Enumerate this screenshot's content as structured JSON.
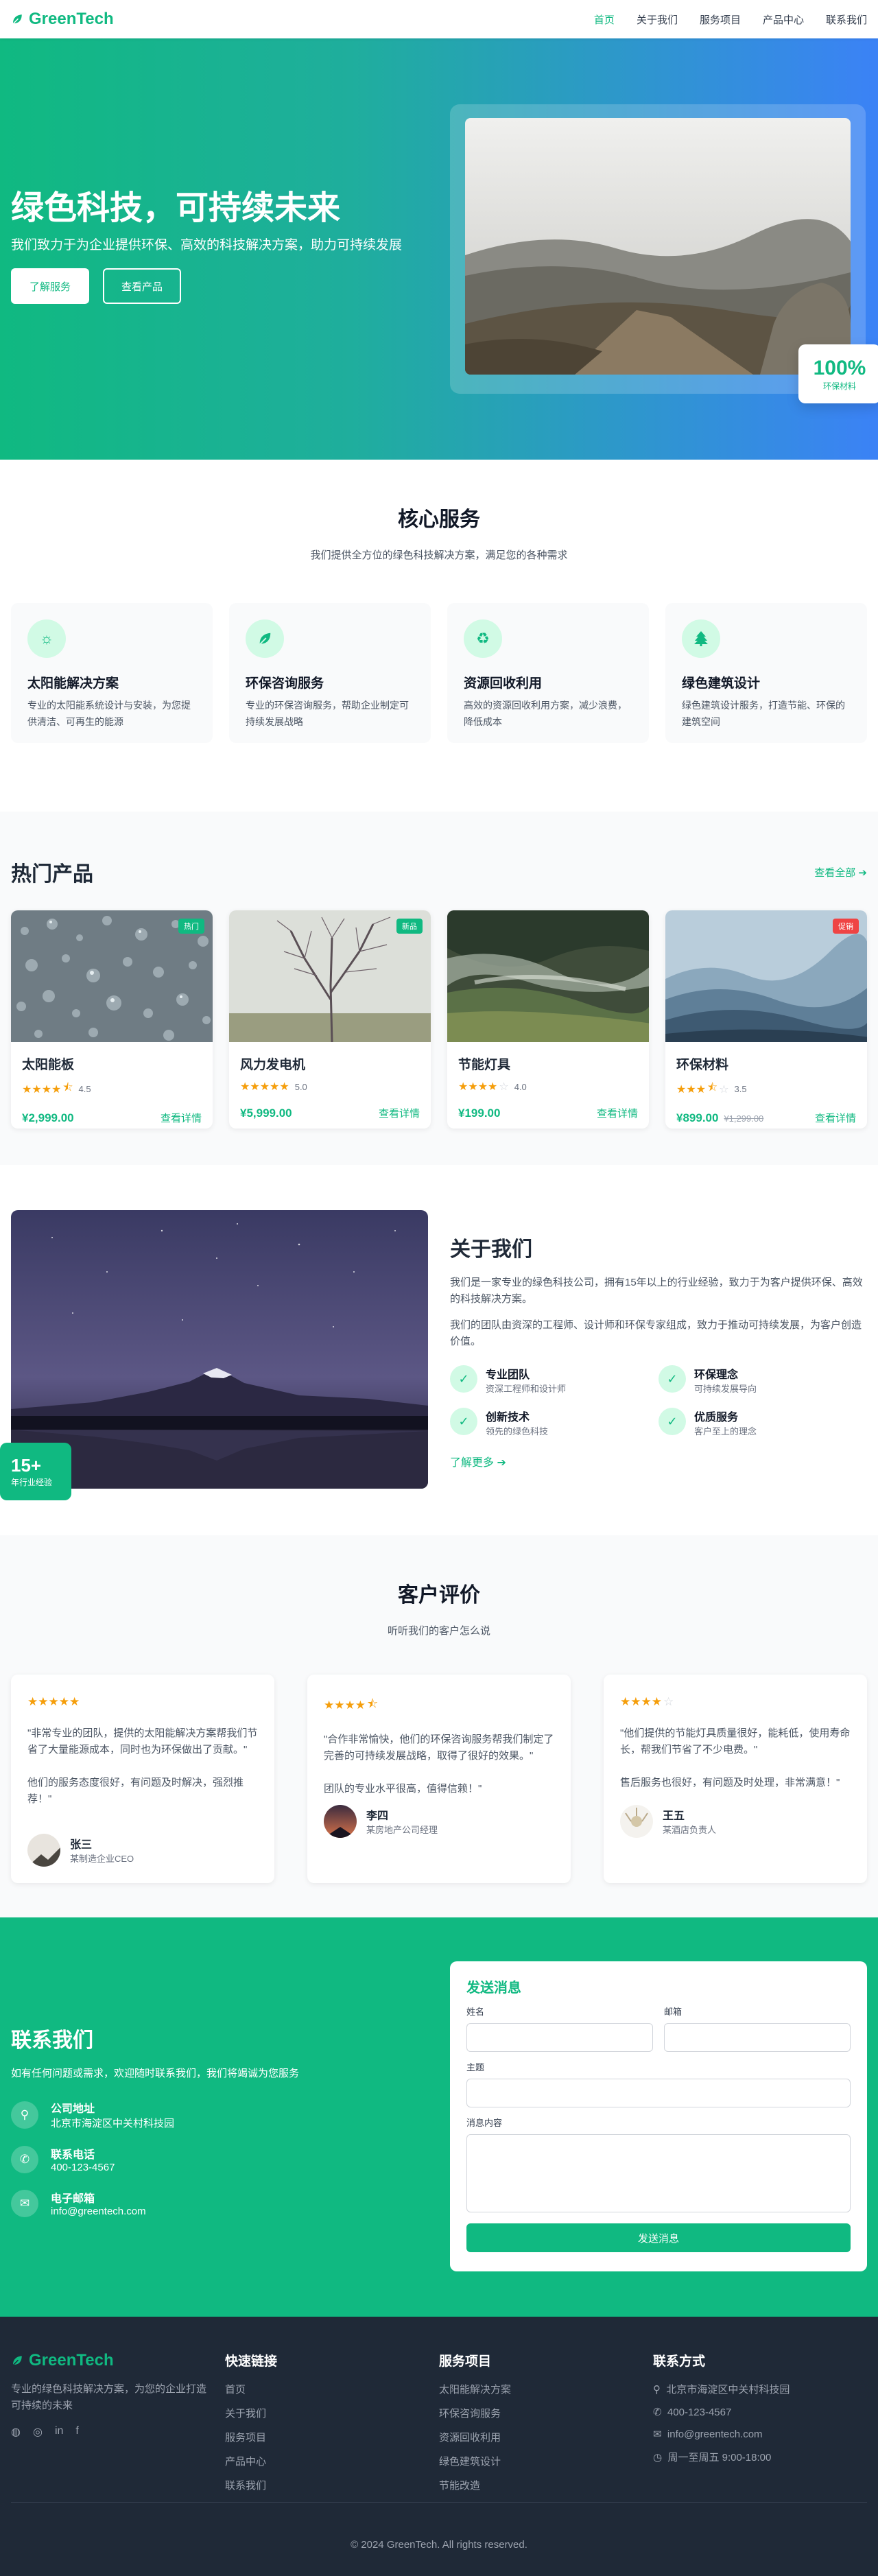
{
  "nav": {
    "logo": "GreenTech",
    "links": [
      "首页",
      "关于我们",
      "服务项目",
      "产品中心",
      "联系我们"
    ]
  },
  "hero": {
    "title": "绿色科技，可持续未来",
    "subtitle": "我们致力于为企业提供环保、高效的科技解决方案，助力可持续发展",
    "btn_primary": "了解服务",
    "btn_secondary": "查看产品",
    "badge_value": "100%",
    "badge_label": "环保材料"
  },
  "services": {
    "title": "核心服务",
    "subtitle": "我们提供全方位的绿色科技解决方案，满足您的各种需求",
    "items": [
      {
        "icon": "sun-icon",
        "title": "太阳能解决方案",
        "desc": "专业的太阳能系统设计与安装，为您提供清洁、可再生的能源"
      },
      {
        "icon": "leaf-icon",
        "title": "环保咨询服务",
        "desc": "专业的环保咨询服务，帮助企业制定可持续发展战略"
      },
      {
        "icon": "recycle-icon",
        "title": "资源回收利用",
        "desc": "高效的资源回收利用方案，减少浪费，降低成本"
      },
      {
        "icon": "tree-icon",
        "title": "绿色建筑设计",
        "desc": "绿色建筑设计服务，打造节能、环保的建筑空间"
      }
    ]
  },
  "products": {
    "title": "热门产品",
    "view_all": "查看全部",
    "detail_label": "查看详情",
    "items": [
      {
        "name": "太阳能板",
        "rating": "4.5",
        "stars": 4.5,
        "price": "¥2,999.00",
        "old_price": "",
        "tag": "热门",
        "tag_color": "#10b981"
      },
      {
        "name": "风力发电机",
        "rating": "5.0",
        "stars": 5,
        "price": "¥5,999.00",
        "old_price": "",
        "tag": "新品",
        "tag_color": "#10b981"
      },
      {
        "name": "节能灯具",
        "rating": "4.0",
        "stars": 4,
        "price": "¥199.00",
        "old_price": "",
        "tag": "",
        "tag_color": ""
      },
      {
        "name": "环保材料",
        "rating": "3.5",
        "stars": 3.5,
        "price": "¥899.00",
        "old_price": "¥1,299.00",
        "tag": "促销",
        "tag_color": "#ef4444"
      }
    ]
  },
  "about": {
    "title": "关于我们",
    "p1": "我们是一家专业的绿色科技公司，拥有15年以上的行业经验，致力于为客户提供环保、高效的科技解决方案。",
    "p2": "我们的团队由资深的工程师、设计师和环保专家组成，致力于推动可持续发展，为客户创造价值。",
    "badge_value": "15+",
    "badge_label": "年行业经验",
    "features": [
      {
        "title": "专业团队",
        "desc": "资深工程师和设计师"
      },
      {
        "title": "环保理念",
        "desc": "可持续发展导向"
      },
      {
        "title": "创新技术",
        "desc": "领先的绿色科技"
      },
      {
        "title": "优质服务",
        "desc": "客户至上的理念"
      }
    ],
    "more": "了解更多"
  },
  "reviews": {
    "title": "客户评价",
    "subtitle": "听听我们的客户怎么说",
    "items": [
      {
        "stars": 5,
        "text": "\"非常专业的团队，提供的太阳能解决方案帮我们节省了大量能源成本，同时也为环保做出了贡献。\"\n\n他们的服务态度很好，有问题及时解决，强烈推荐！\"",
        "name": "张三",
        "role": "某制造企业CEO"
      },
      {
        "stars": 4.5,
        "text": "\"合作非常愉快，他们的环保咨询服务帮我们制定了完善的可持续发展战略，取得了很好的效果。\"\n\n团队的专业水平很高，值得信赖！\"",
        "name": "李四",
        "role": "某房地产公司经理"
      },
      {
        "stars": 4,
        "text": "\"他们提供的节能灯具质量很好，能耗低，使用寿命长，帮我们节省了不少电费。\"\n\n售后服务也很好，有问题及时处理，非常满意！\"",
        "name": "王五",
        "role": "某酒店负责人"
      }
    ]
  },
  "contact": {
    "title": "联系我们",
    "subtitle": "如有任何问题或需求，欢迎随时联系我们，我们将竭诚为您服务",
    "items": [
      {
        "icon": "location-icon",
        "label": "公司地址",
        "value": "北京市海淀区中关村科技园"
      },
      {
        "icon": "phone-icon",
        "label": "联系电话",
        "value": "400-123-4567"
      },
      {
        "icon": "mail-icon",
        "label": "电子邮箱",
        "value": "info@greentech.com"
      }
    ],
    "form": {
      "title": "发送消息",
      "name_label": "姓名",
      "email_label": "邮箱",
      "subject_label": "主题",
      "message_label": "消息内容",
      "submit": "发送消息"
    }
  },
  "footer": {
    "logo": "GreenTech",
    "desc": "专业的绿色科技解决方案，为您的企业打造可持续的未来",
    "quick_title": "快速链接",
    "quick_links": [
      "首页",
      "关于我们",
      "服务项目",
      "产品中心",
      "联系我们"
    ],
    "service_title": "服务项目",
    "service_links": [
      "太阳能解决方案",
      "环保咨询服务",
      "资源回收利用",
      "绿色建筑设计",
      "节能改造"
    ],
    "contact_title": "联系方式",
    "contact_items": [
      {
        "icon": "location-icon",
        "value": "北京市海淀区中关村科技园"
      },
      {
        "icon": "phone-icon",
        "value": "400-123-4567"
      },
      {
        "icon": "mail-icon",
        "value": "info@greentech.com"
      },
      {
        "icon": "clock-icon",
        "value": "周一至周五 9:00-18:00"
      }
    ],
    "copyright": "© 2024 GreenTech. All rights reserved."
  },
  "colors": {
    "brand": "#10b981",
    "brand_light": "#d1fae5",
    "hero_end": "#3b82f6",
    "footer_bg": "#1f2937"
  }
}
